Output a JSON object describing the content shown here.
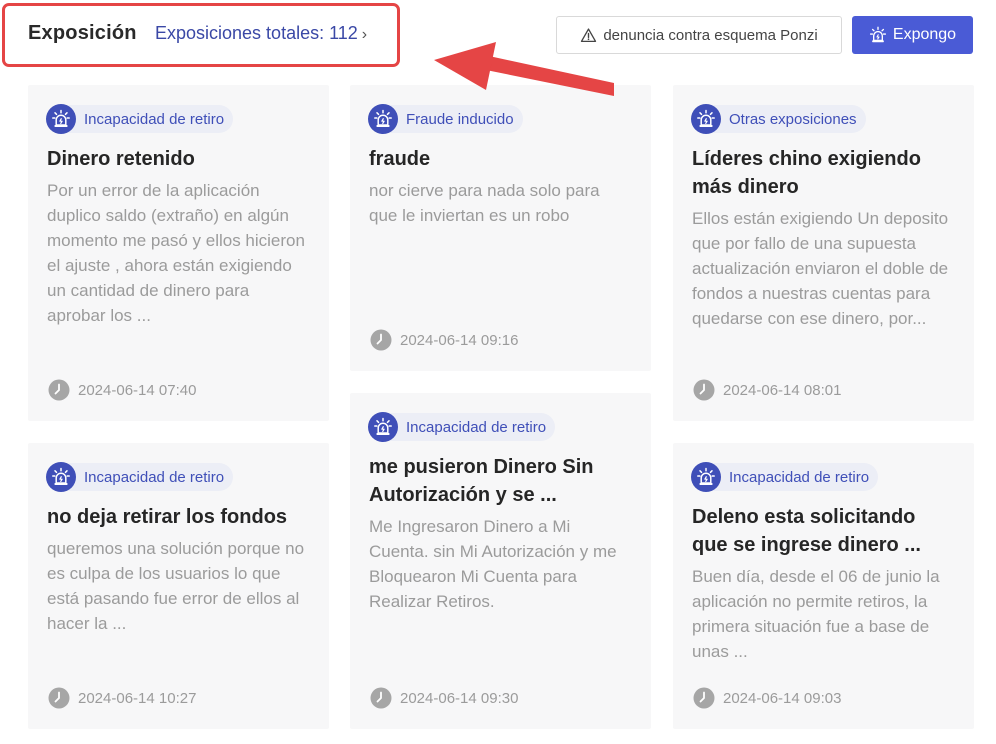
{
  "header": {
    "title": "Exposición",
    "total_link": "Exposiciones totales: 112",
    "chevron": "›",
    "report_button": "denuncia contra esquema Ponzi",
    "expose_button": "Expongo"
  },
  "icons": {
    "report": "warning-triangle-icon",
    "expose": "siren-alarm-icon",
    "tag": "siren-alarm-icon",
    "time": "clock-icon"
  },
  "colors": {
    "accent": "#4a5bd6",
    "tag_text": "#3f4fb8",
    "highlight": "#e54545"
  },
  "cards": [
    {
      "tag": "Incapacidad de retiro",
      "title": "Dinero retenido",
      "body": "Por un error de la aplicación duplico saldo (extraño) en algún momento me pasó y ellos hicieron el ajuste , ahora están exigiendo un cantidad de dinero para aprobar los ...",
      "time": "2024-06-14 07:40"
    },
    {
      "tag": "Fraude inducido",
      "title": "fraude",
      "body": "nor cierve para nada solo para que le inviertan es un robo",
      "time": "2024-06-14 09:16"
    },
    {
      "tag": "Otras exposiciones",
      "title": "Líderes chino exigiendo más dinero",
      "body": "Ellos están exigiendo Un deposito que por fallo de una supuesta actualización enviaron el doble de fondos a nuestras cuentas para quedarse con ese dinero, por...",
      "time": "2024-06-14 08:01"
    },
    {
      "tag": "Incapacidad de retiro",
      "title": "no deja retirar los fondos",
      "body": "queremos una solución porque no es culpa de los usuarios lo que está pasando fue error de ellos al hacer la ...",
      "time": "2024-06-14 10:27"
    },
    {
      "tag": "Incapacidad de retiro",
      "title": "me pusieron Dinero Sin Autorización y se ...",
      "body": "Me Ingresaron Dinero a Mi Cuenta. sin Mi Autorización y me Bloquearon Mi Cuenta para Realizar Retiros.",
      "time": "2024-06-14 09:30"
    },
    {
      "tag": "Incapacidad de retiro",
      "title": "Deleno esta solicitando que se ingrese dinero ...",
      "body": "Buen día, desde el 06 de junio la aplicación no permite retiros, la primera situación fue a base de unas ...",
      "time": "2024-06-14 09:03"
    }
  ]
}
